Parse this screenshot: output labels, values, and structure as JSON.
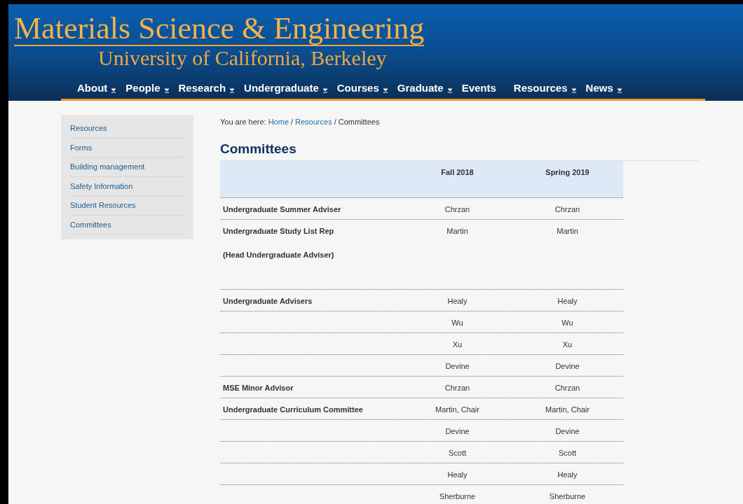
{
  "header": {
    "title": "Materials Science & Engineering",
    "subtitle": "University of California, Berkeley"
  },
  "nav": [
    {
      "label": "About",
      "dropdown": true
    },
    {
      "label": "People",
      "dropdown": true
    },
    {
      "label": "Research",
      "dropdown": true
    },
    {
      "label": "Undergraduate",
      "dropdown": true
    },
    {
      "label": "Courses",
      "dropdown": true
    },
    {
      "label": "Graduate",
      "dropdown": true
    },
    {
      "label": "Events",
      "dropdown": false
    },
    {
      "label": "Resources",
      "dropdown": true
    },
    {
      "label": "News",
      "dropdown": true
    }
  ],
  "sidebar": {
    "items": [
      "Resources",
      "Forms",
      "Building management",
      "Safety Information",
      "Student Resources",
      "Committees"
    ]
  },
  "breadcrumb": {
    "prefix": "You are here:",
    "links": [
      "Home",
      "Resources"
    ],
    "separator": "/",
    "current": "Committees"
  },
  "page_title": "Committees",
  "table": {
    "columns": [
      "Fall 2018",
      "Spring 2019"
    ],
    "rows": [
      {
        "label": [
          "Undergraduate Summer Adviser"
        ],
        "cells": [
          "Chrzan",
          "Chrzan"
        ]
      },
      {
        "label": [
          "Undergraduate Study List Rep",
          "(Head Undergraduate Adviser)"
        ],
        "cells": [
          "Martin",
          "Martin"
        ]
      },
      {
        "label": [
          "Undergraduate Advisers"
        ],
        "cells": [
          "Healy",
          "Healy"
        ]
      },
      {
        "label": [],
        "cells": [
          "Wu",
          "Wu"
        ]
      },
      {
        "label": [],
        "cells": [
          "Xu",
          "Xu"
        ]
      },
      {
        "label": [],
        "cells": [
          "Devine",
          "Devine"
        ]
      },
      {
        "label": [
          "MSE Minor Advisor"
        ],
        "cells": [
          "Chrzan",
          "Chrzan"
        ]
      },
      {
        "label": [
          "Undergraduate Curriculum Committee"
        ],
        "cells": [
          "Martin, Chair",
          "Martin, Chair"
        ]
      },
      {
        "label": [],
        "cells": [
          "Devine",
          "Devine"
        ]
      },
      {
        "label": [],
        "cells": [
          "Scott",
          "Scott"
        ]
      },
      {
        "label": [],
        "cells": [
          "Healy",
          "Healy"
        ]
      },
      {
        "label": [],
        "cells": [
          "Sherburne",
          "Sherburne"
        ]
      }
    ]
  }
}
